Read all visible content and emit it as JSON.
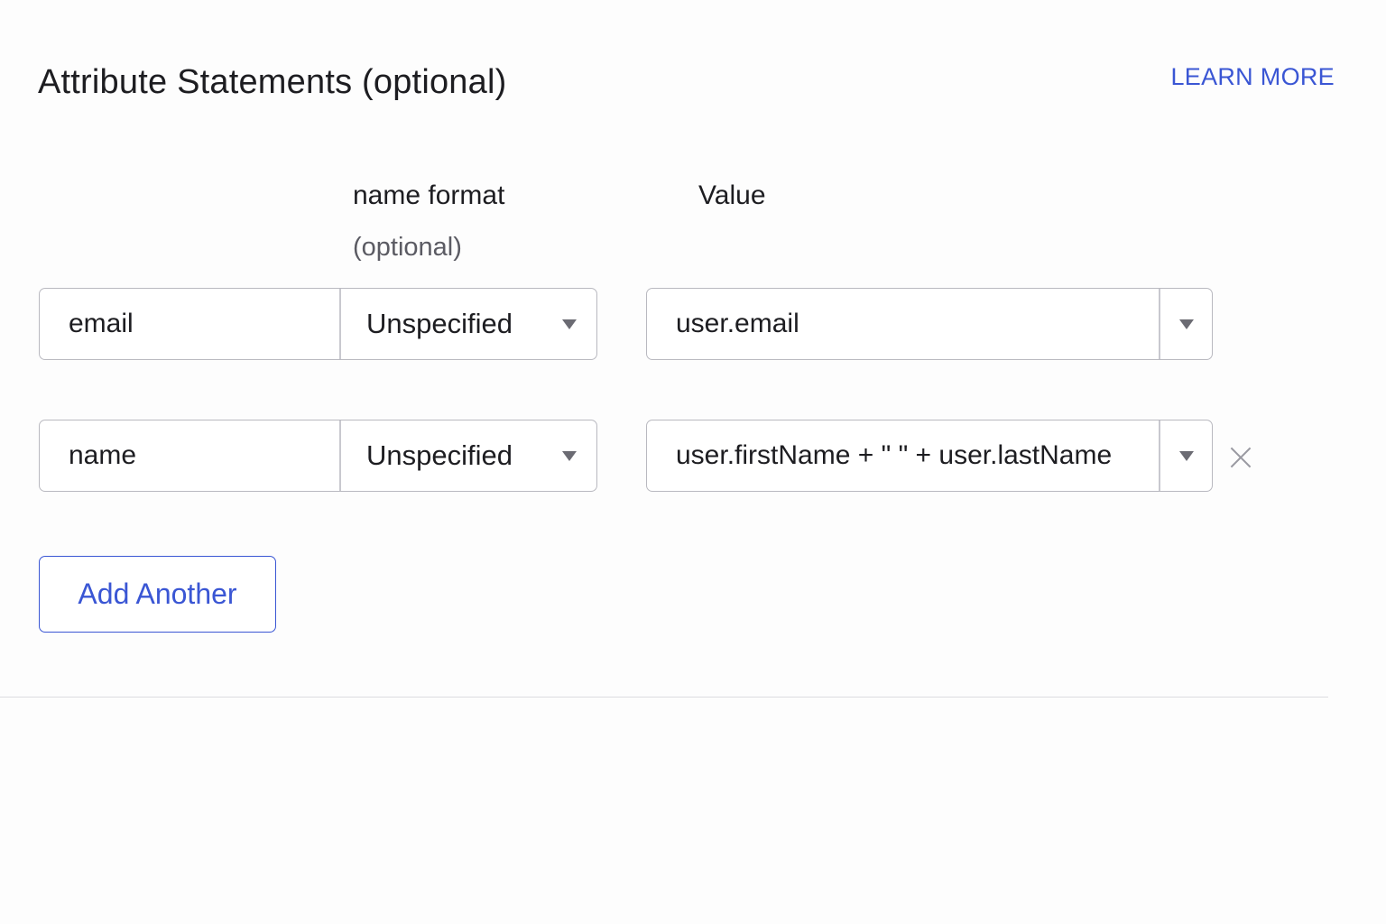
{
  "section": {
    "title": "Attribute Statements (optional)",
    "learn_more": "LEARN MORE"
  },
  "columns": {
    "name_format": "name format",
    "name_format_sub": "(optional)",
    "value": "Value"
  },
  "rows": [
    {
      "name": "email",
      "format": "Unspecified",
      "value": "user.email",
      "removable": false
    },
    {
      "name": "name",
      "format": "Unspecified",
      "value": "user.firstName + \" \" + user.lastName",
      "removable": true
    }
  ],
  "actions": {
    "add_another": "Add Another"
  },
  "colors": {
    "accent": "#3a56d4",
    "text": "#1d1d21",
    "muted": "#5b5b63",
    "border": "#b9b9c0"
  },
  "icons": {
    "dropdown": "caret-down-icon",
    "remove": "close-icon"
  }
}
